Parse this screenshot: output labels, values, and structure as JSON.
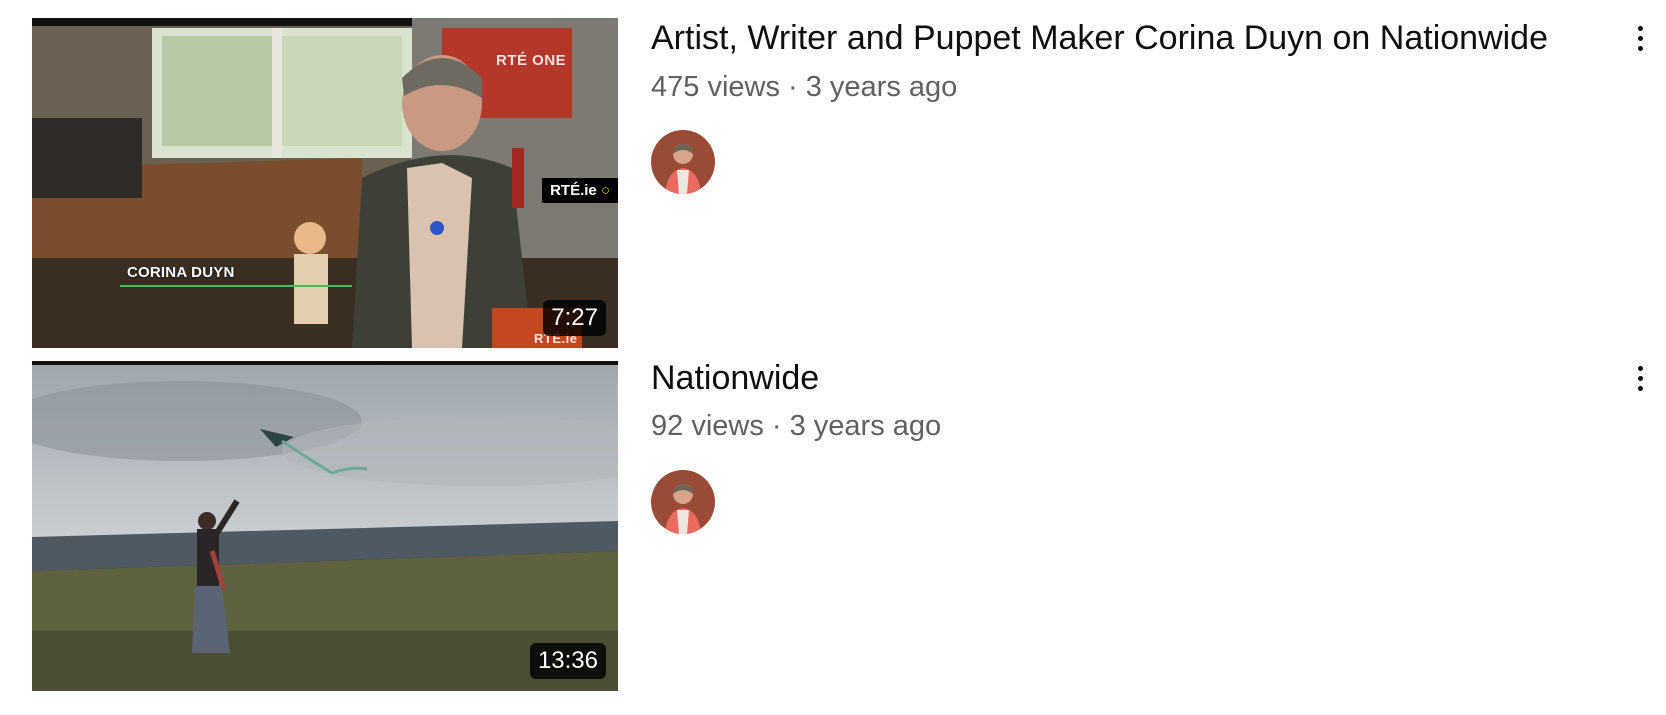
{
  "videos": [
    {
      "title": "Artist, Writer and Puppet Maker Corina Duyn on Nationwide",
      "views": "475 views",
      "age": "3 years ago",
      "meta": "475 views · 3 years ago",
      "duration": "7:27",
      "overlay_name": "CORINA DUYN",
      "channel_mark": "RTÉ ONE",
      "badge": "RTÉ.ie",
      "corner_mark": "RTÉ.ie",
      "more_icon": "more-vert-icon"
    },
    {
      "title": "Nationwide",
      "views": "92 views",
      "age": "3 years ago",
      "meta": "92 views · 3 years ago",
      "duration": "13:36",
      "more_icon": "more-vert-icon"
    }
  ],
  "colors": {
    "title": "#0f0f0f",
    "meta": "#606060",
    "duration_bg": "#000000",
    "rte_accent": "#f2c400"
  }
}
